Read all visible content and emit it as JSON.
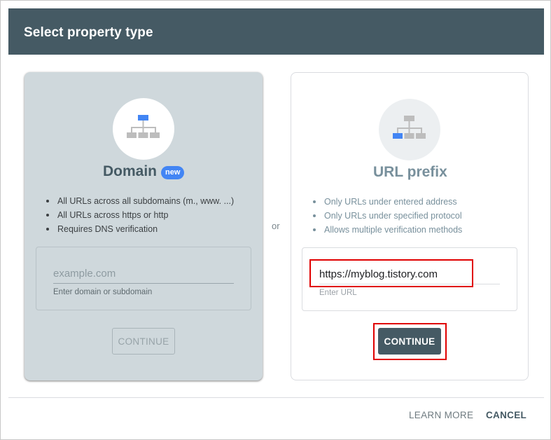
{
  "dialog": {
    "title": "Select property type"
  },
  "domain_card": {
    "title": "Domain",
    "badge": "new",
    "icon": "sitemap-icon",
    "features": [
      "All URLs across all subdomains (m., www. ...)",
      "All URLs across https or http",
      "Requires DNS verification"
    ],
    "input": {
      "value": "",
      "placeholder": "example.com",
      "helper": "Enter domain or subdomain"
    },
    "continue_label": "CONTINUE"
  },
  "separator": "or",
  "url_card": {
    "title": "URL prefix",
    "icon": "sitemap-icon",
    "features": [
      "Only URLs under entered address",
      "Only URLs under specified protocol",
      "Allows multiple verification methods"
    ],
    "input": {
      "value": "https://myblog.tistory.com",
      "placeholder": "",
      "helper": "Enter URL"
    },
    "continue_label": "CONTINUE"
  },
  "footer": {
    "learn_more_label": "LEARN MORE",
    "cancel_label": "CANCEL"
  },
  "colors": {
    "header": "#455a64",
    "accent": "#4285f4",
    "highlight": "#e00000",
    "domain_card_bg": "#cfd8dc"
  }
}
